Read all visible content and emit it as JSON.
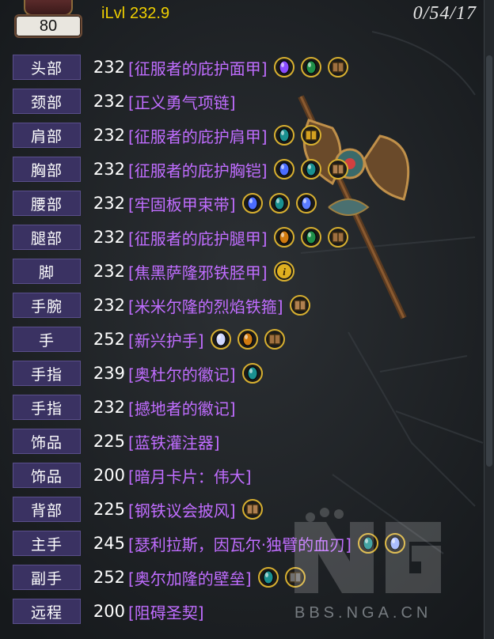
{
  "header": {
    "level": "80",
    "ilvl_label": "iLvl",
    "ilvl_value": "232.9",
    "counter": "0/54/17"
  },
  "equipment": [
    {
      "slot": "头部",
      "ilvl": "232",
      "item": "[征服者的庇护面甲]",
      "gems": [
        {
          "icon": "purple-gem-icon",
          "color": "#8a4cff"
        },
        {
          "icon": "green-gem-icon",
          "color": "#1f8f4a"
        },
        {
          "icon": "socket-icon",
          "color": "#a07040"
        }
      ]
    },
    {
      "slot": "颈部",
      "ilvl": "232",
      "item": "[正义勇气项链]",
      "gems": []
    },
    {
      "slot": "肩部",
      "ilvl": "232",
      "item": "[征服者的庇护肩甲]",
      "gems": [
        {
          "icon": "teal-gem-icon",
          "color": "#1a9090"
        },
        {
          "icon": "yellow-enchant-icon",
          "color": "#d4a020"
        }
      ]
    },
    {
      "slot": "胸部",
      "ilvl": "232",
      "item": "[征服者的庇护胸铠]",
      "gems": [
        {
          "icon": "blue-gem-icon",
          "color": "#4a6cff"
        },
        {
          "icon": "teal-gem-icon",
          "color": "#1a9090"
        },
        {
          "icon": "socket-icon",
          "color": "#b08050"
        }
      ]
    },
    {
      "slot": "腰部",
      "ilvl": "232",
      "item": "[牢固板甲束带]",
      "gems": [
        {
          "icon": "blue-gem-icon",
          "color": "#4a6cff"
        },
        {
          "icon": "teal-gem-icon",
          "color": "#1a9090"
        },
        {
          "icon": "blue-gem-icon",
          "color": "#5a7cff"
        }
      ]
    },
    {
      "slot": "腿部",
      "ilvl": "232",
      "item": "[征服者的庇护腿甲]",
      "gems": [
        {
          "icon": "orange-gem-icon",
          "color": "#d07a10"
        },
        {
          "icon": "green-gem-icon",
          "color": "#1f8f4a"
        },
        {
          "icon": "socket-icon",
          "color": "#a07040"
        }
      ]
    },
    {
      "slot": "脚",
      "ilvl": "232",
      "item": "[焦黑萨隆邪铁胫甲]",
      "gems": [
        {
          "icon": "info-icon",
          "color": "#e0b020"
        }
      ]
    },
    {
      "slot": "手腕",
      "ilvl": "232",
      "item": "[米米尔隆的烈焰铁箍]",
      "gems": [
        {
          "icon": "socket-icon",
          "color": "#b08050"
        }
      ]
    },
    {
      "slot": "手",
      "ilvl": "252",
      "item": "[新兴护手]",
      "gems": [
        {
          "icon": "white-gem-icon",
          "color": "#d0d8ff"
        },
        {
          "icon": "orange-gem-icon",
          "color": "#d07a10"
        },
        {
          "icon": "socket-icon",
          "color": "#a07040"
        }
      ]
    },
    {
      "slot": "手指",
      "ilvl": "239",
      "item": "[奥杜尔的徽记]",
      "gems": [
        {
          "icon": "teal-gem-icon",
          "color": "#1a9090"
        }
      ]
    },
    {
      "slot": "手指",
      "ilvl": "232",
      "item": "[撼地者的徽记]",
      "gems": []
    },
    {
      "slot": "饰品",
      "ilvl": "225",
      "item": "[蓝铁灌注器]",
      "gems": []
    },
    {
      "slot": "饰品",
      "ilvl": "200",
      "item": "[暗月卡片：伟大]",
      "gems": []
    },
    {
      "slot": "背部",
      "ilvl": "225",
      "item": "[钢铁议会披风]",
      "gems": [
        {
          "icon": "socket-icon",
          "color": "#b08050"
        }
      ]
    },
    {
      "slot": "主手",
      "ilvl": "245",
      "item": "[瑟利拉斯，因瓦尔·独臂的血刃]",
      "gems": [
        {
          "icon": "teal-gem-icon",
          "color": "#1a9090"
        },
        {
          "icon": "white-gem-icon",
          "color": "#9ab0ff"
        }
      ]
    },
    {
      "slot": "副手",
      "ilvl": "252",
      "item": "[奥尔加隆的壁垒]",
      "gems": [
        {
          "icon": "teal-gem-icon",
          "color": "#1a9090"
        },
        {
          "icon": "grey-socket-icon",
          "color": "#707070"
        }
      ]
    },
    {
      "slot": "远程",
      "ilvl": "200",
      "item": "[阻碍圣契]",
      "gems": []
    }
  ],
  "watermark": {
    "text": "BBS.NGA.CN"
  }
}
